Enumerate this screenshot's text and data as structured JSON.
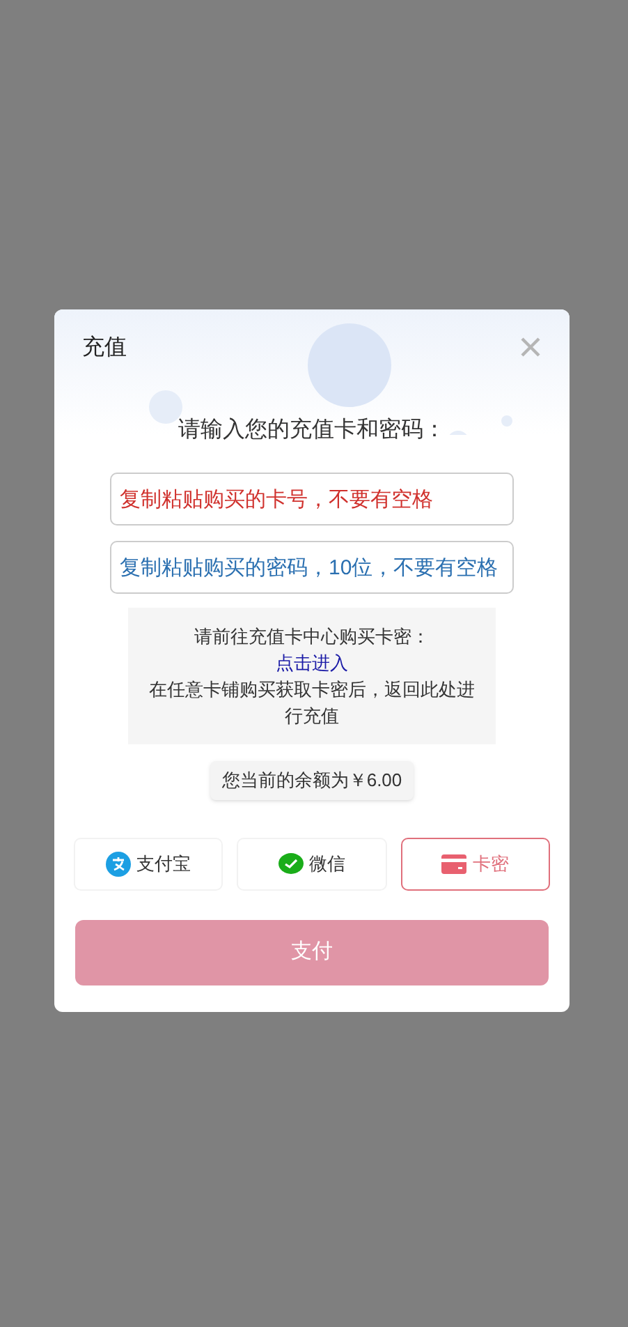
{
  "dialog": {
    "title": "充值",
    "prompt": "请输入您的充值卡和密码：",
    "fields": [
      {
        "placeholder": "复制粘贴购买的卡号，不要有空格",
        "color": "#d0312d"
      },
      {
        "placeholder": "复制粘贴购买的密码，10位，不要有空格",
        "color": "#2a6fb0"
      }
    ],
    "notice": {
      "line_1": "请前往充值卡中心购买卡密：",
      "link": "点击进入",
      "line_2": "在任意卡铺购买获取卡密后，返回此处进行充值"
    },
    "balance": "您当前的余额为￥6.00",
    "methods": [
      {
        "kind": "alipay",
        "label": "支付宝",
        "selected": false
      },
      {
        "kind": "wechat",
        "label": "微信",
        "selected": false
      },
      {
        "kind": "card",
        "label": "卡密",
        "selected": true
      }
    ],
    "pay_button": "支付"
  }
}
